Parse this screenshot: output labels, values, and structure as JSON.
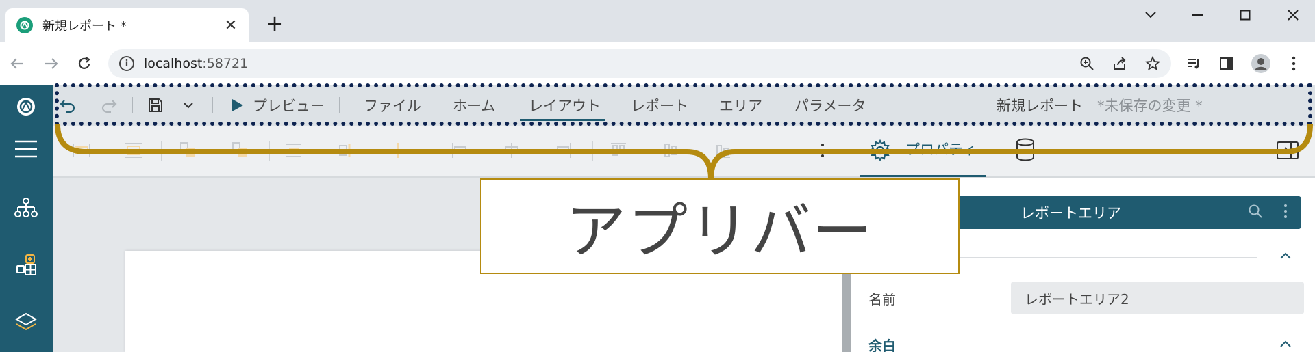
{
  "browser": {
    "tab_title": "新規レポート *",
    "tab_close": "✕",
    "new_tab": "+",
    "url_host": "localhost",
    "url_port": ":58721"
  },
  "appbar": {
    "preview": "プレビュー",
    "menu": [
      "ファイル",
      "ホーム",
      "レイアウト",
      "レポート",
      "エリア",
      "パラメータ"
    ],
    "active_menu": "レイアウト",
    "document_title": "新規レポート",
    "unsaved": "*未保存の変更 *"
  },
  "ribbon": {
    "properties_tab": "プロパティ"
  },
  "property_panel": {
    "header_title": "レポートエリア",
    "name_label": "名前",
    "name_value": "レポートエリア2",
    "margin_section": "余白"
  },
  "annotation": {
    "callout_text": "アプリバー",
    "box_color": "#0d2350",
    "bracket_color": "#b58b10"
  },
  "colors": {
    "brand_teal": "#1f5b70",
    "favicon_green": "#1b9e7a"
  }
}
